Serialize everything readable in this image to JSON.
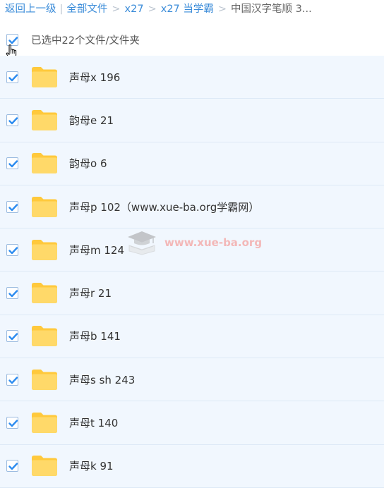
{
  "breadcrumb": {
    "back": "返回上一级",
    "all_files": "全部文件",
    "crumb1": "x27",
    "crumb2": "x27 当学霸",
    "current": "中国汉字笔顺 3..."
  },
  "selection": {
    "text": "已选中22个文件/文件夹"
  },
  "files": [
    {
      "name": "声母x 196"
    },
    {
      "name": "韵母e 21"
    },
    {
      "name": "韵母o 6"
    },
    {
      "name": "声母p 102（www.xue-ba.org学霸网）"
    },
    {
      "name": "声母m 124"
    },
    {
      "name": "声母r 21"
    },
    {
      "name": "声母b 141"
    },
    {
      "name": "声母s sh 243"
    },
    {
      "name": "声母t 140"
    },
    {
      "name": "声母k 91"
    }
  ],
  "watermark": {
    "text": "www.xue-ba.org"
  },
  "colors": {
    "link": "#3b8cd9",
    "row_bg": "#f1f7fe",
    "check": "#2d8cf0",
    "folder": "#ffd666"
  }
}
